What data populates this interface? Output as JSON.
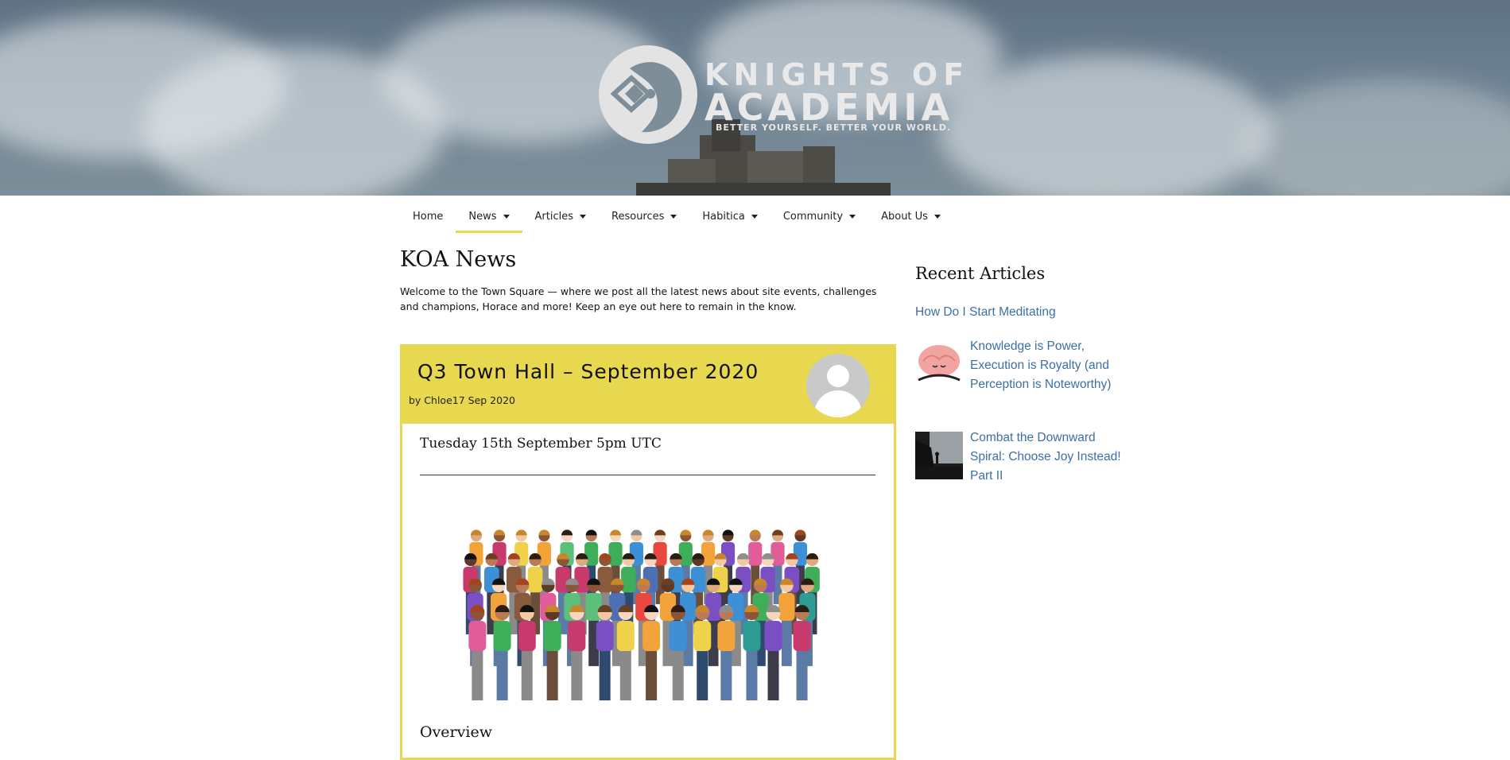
{
  "hero": {
    "logo_line1": "KNIGHTS OF",
    "logo_line2": "ACADEMIA",
    "tagline": "BETTER YOURSELF. BETTER YOUR WORLD."
  },
  "nav": {
    "items": [
      {
        "label": "Home",
        "has_dropdown": false
      },
      {
        "label": "News",
        "has_dropdown": true,
        "active": true
      },
      {
        "label": "Articles",
        "has_dropdown": true
      },
      {
        "label": "Resources",
        "has_dropdown": true
      },
      {
        "label": "Habitica",
        "has_dropdown": true
      },
      {
        "label": "Community",
        "has_dropdown": true
      },
      {
        "label": "About Us",
        "has_dropdown": true
      }
    ]
  },
  "main": {
    "title": "KOA News",
    "intro": "Welcome to the Town Square — where we post all the latest news about site events, challenges and champions, Horace and more! Keep an eye out here to remain in the know."
  },
  "post": {
    "title": "Q3 Town Hall – September 2020",
    "meta": "by Chloe17 Sep 2020",
    "date_heading": "Tuesday 15th September 5pm UTC",
    "section_heading": "Overview"
  },
  "sidebar": {
    "title": "Recent Articles",
    "articles": [
      {
        "title": "How Do I Start Meditating",
        "has_thumb": false
      },
      {
        "title": "Knowledge is Power, Execution is Royalty (and Perception is Noteworthy)",
        "has_thumb": true,
        "thumb_icon": "brain-thumbnail"
      },
      {
        "title": "Combat the Downward Spiral: Choose Joy Instead! Part II",
        "has_thumb": true,
        "thumb_icon": "silhouette-thumbnail"
      }
    ]
  },
  "colors": {
    "accent_yellow": "#e8d84f",
    "link_blue": "#3b6fa6",
    "hero_sky": "#6f8393"
  }
}
